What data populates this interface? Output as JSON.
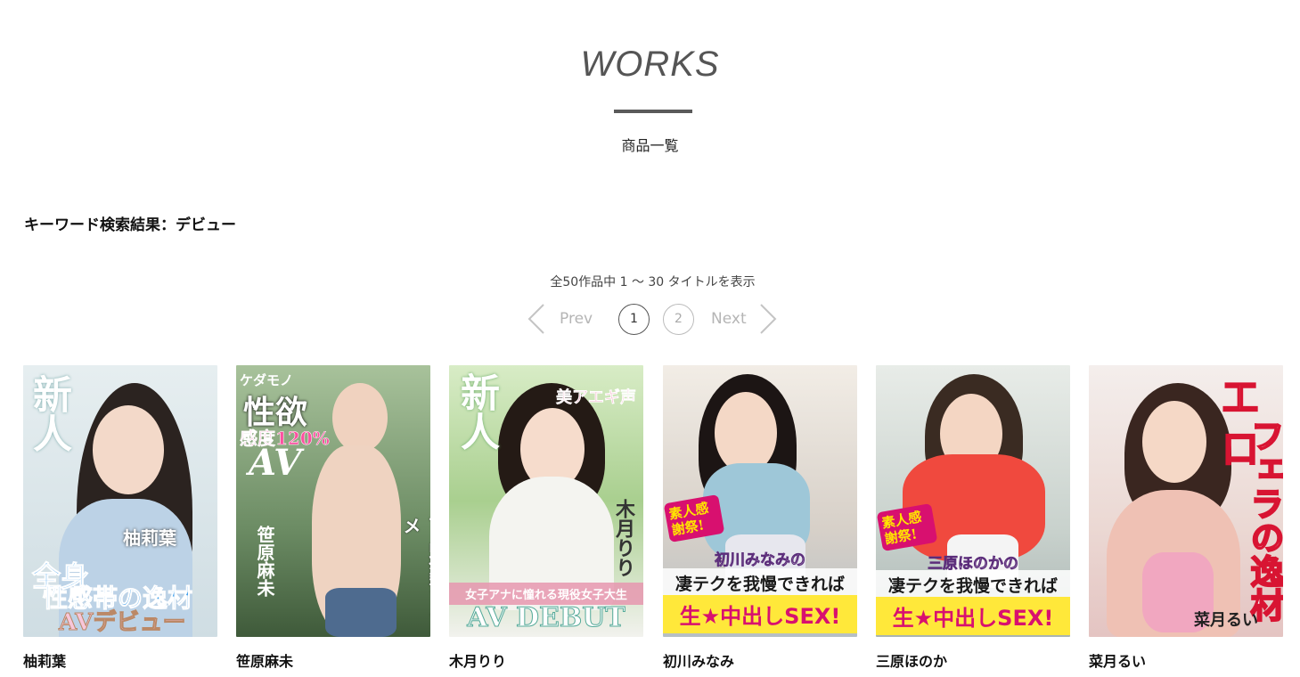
{
  "header": {
    "title": "WORKS",
    "subtitle": "商品一覧"
  },
  "search": {
    "result_label": "キーワード検索結果：デビュー"
  },
  "results": {
    "summary": "全50作品中 1 〜 30 タイトルを表示"
  },
  "pagination": {
    "prev_label": "Prev",
    "next_label": "Next",
    "pages": [
      "1",
      "2"
    ],
    "current_page": "1"
  },
  "works": [
    {
      "name": "柚莉葉",
      "cover": {
        "badge": "新人",
        "name_text": "柚莉葉",
        "headline1": "全身",
        "headline2": "性感帯の逸材",
        "footer": "AVデビュー",
        "accent": "#2f8fd6",
        "bg": "#dfe9ec"
      }
    },
    {
      "name": "笹原麻未",
      "cover": {
        "top": "ケダモノ",
        "headline1": "性欲",
        "headline2": "感度120%",
        "headline3": "AV",
        "name_text": "笹原麻未",
        "footer": "下品痙攣アクメ",
        "accent": "#2c6c3a",
        "bg": "#9bb58e"
      }
    },
    {
      "name": "木月りり",
      "cover": {
        "badge": "新人",
        "headline1": "美アエギ声",
        "name_text": "木月りり",
        "band": "女子アナに憧れる現役女子大生",
        "footer": "AV DEBUT",
        "accent": "#e39ab0",
        "bg": "#cfe7b8"
      }
    },
    {
      "name": "初川みなみ",
      "cover": {
        "badge": "素人感謝祭!",
        "headline1": "初川みなみの",
        "headline2": "凄テクを我慢できれば",
        "footer": "生★中出しSEX!",
        "accent": "#d8106f",
        "bg": "#e9dccf"
      }
    },
    {
      "name": "三原ほのか",
      "cover": {
        "badge": "素人感謝祭!",
        "headline1": "三原ほのかの",
        "headline2": "凄テクを我慢できれば",
        "footer": "生★中出しSEX!",
        "accent": "#d8106f",
        "bg": "#dfe3df"
      }
    },
    {
      "name": "菜月るい",
      "cover": {
        "headline1": "フェラの逸材",
        "headline2": "工口",
        "name_text": "菜月るい",
        "accent": "#d81432",
        "bg": "#f0e7e5"
      }
    }
  ]
}
